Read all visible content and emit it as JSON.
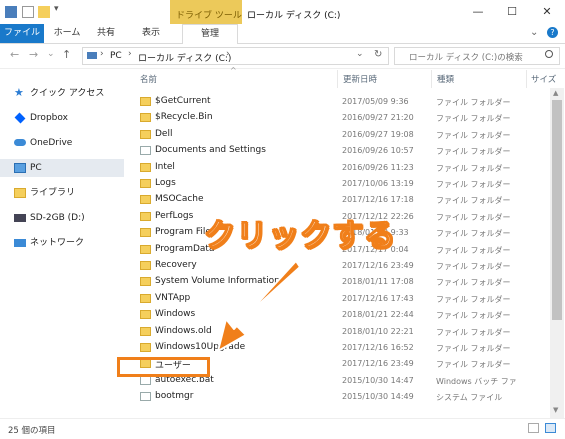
{
  "window": {
    "title": "ローカル ディスク (C:)",
    "context_tab_group": "ドライブ ツール",
    "minimize": "—",
    "maximize": "☐",
    "close": "✕"
  },
  "ribbon": {
    "tabs": [
      "ファイル",
      "ホーム",
      "共有",
      "表示",
      "管理"
    ],
    "expand": "⌄",
    "help": "?"
  },
  "nav": {
    "back": "←",
    "forward": "→",
    "recent": "⌄",
    "up": "↑",
    "breadcrumb": [
      "PC",
      "ローカル ディスク (C:)"
    ],
    "separator": "›",
    "dropdown": "⌄",
    "refresh": "↻",
    "search_placeholder": "ローカル ディスク (C:)の検索"
  },
  "sidebar": {
    "items": [
      {
        "label": "クイック アクセス",
        "icon": "star-icon"
      },
      {
        "label": "Dropbox",
        "icon": "dropbox-icon"
      },
      {
        "label": "OneDrive",
        "icon": "cloud-icon"
      },
      {
        "label": "PC",
        "icon": "computer-icon"
      },
      {
        "label": "ライブラリ",
        "icon": "library-icon"
      },
      {
        "label": "SD-2GB (D:)",
        "icon": "drive-icon"
      },
      {
        "label": "ネットワーク",
        "icon": "network-icon"
      }
    ]
  },
  "columns": {
    "name": "名前",
    "modified": "更新日時",
    "type": "種類",
    "size": "サイズ"
  },
  "files": [
    {
      "name": "$GetCurrent",
      "modified": "2017/05/09 9:36",
      "type": "ファイル フォルダー",
      "kind": "folder"
    },
    {
      "name": "$Recycle.Bin",
      "modified": "2016/09/27 21:20",
      "type": "ファイル フォルダー",
      "kind": "folder"
    },
    {
      "name": "Dell",
      "modified": "2016/09/27 19:08",
      "type": "ファイル フォルダー",
      "kind": "folder"
    },
    {
      "name": "Documents and Settings",
      "modified": "2016/09/26 10:57",
      "type": "ファイル フォルダー",
      "kind": "link"
    },
    {
      "name": "Intel",
      "modified": "2016/09/26 11:23",
      "type": "ファイル フォルダー",
      "kind": "folder"
    },
    {
      "name": "Logs",
      "modified": "2017/10/06 13:19",
      "type": "ファイル フォルダー",
      "kind": "folder"
    },
    {
      "name": "MSOCache",
      "modified": "2017/12/16 17:18",
      "type": "ファイル フォルダー",
      "kind": "folder"
    },
    {
      "name": "PerfLogs",
      "modified": "2017/12/12 22:26",
      "type": "ファイル フォルダー",
      "kind": "folder"
    },
    {
      "name": "Program Files",
      "modified": "2018/01/23 9:33",
      "type": "ファイル フォルダー",
      "kind": "folder"
    },
    {
      "name": "ProgramData",
      "modified": "2017/12/17 0:04",
      "type": "ファイル フォルダー",
      "kind": "folder"
    },
    {
      "name": "Recovery",
      "modified": "2017/12/16 23:49",
      "type": "ファイル フォルダー",
      "kind": "folder"
    },
    {
      "name": "System Volume Information",
      "modified": "2018/01/11 17:08",
      "type": "ファイル フォルダー",
      "kind": "folder"
    },
    {
      "name": "VNTApp",
      "modified": "2017/12/16 17:43",
      "type": "ファイル フォルダー",
      "kind": "folder"
    },
    {
      "name": "Windows",
      "modified": "2018/01/21 22:44",
      "type": "ファイル フォルダー",
      "kind": "folder"
    },
    {
      "name": "Windows.old",
      "modified": "2018/01/10 22:21",
      "type": "ファイル フォルダー",
      "kind": "folder"
    },
    {
      "name": "Windows10Upgrade",
      "modified": "2017/12/16 16:52",
      "type": "ファイル フォルダー",
      "kind": "folder"
    },
    {
      "name": "ユーザー",
      "modified": "2017/12/16 23:49",
      "type": "ファイル フォルダー",
      "kind": "folder"
    },
    {
      "name": "autoexec.bat",
      "modified": "2015/10/30 14:47",
      "type": "Windows バッチ ファ",
      "kind": "file"
    },
    {
      "name": "bootmgr",
      "modified": "2015/10/30 14:49",
      "type": "システム ファイル",
      "kind": "file"
    }
  ],
  "status": {
    "item_count": "25 個の項目"
  },
  "annotation": {
    "callout": "クリックする",
    "color": "#f07f1a"
  }
}
